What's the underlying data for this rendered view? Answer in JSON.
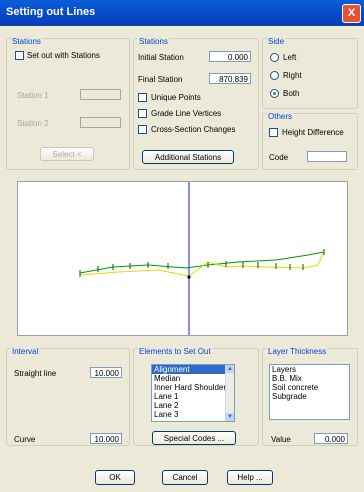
{
  "window": {
    "title": "Setting out Lines",
    "close_glyph": "X"
  },
  "stations_left": {
    "group_label": "Stations",
    "set_out_label": "Set out with Stations",
    "station1_label": "Station 1",
    "station2_label": "Station 2",
    "select_label": "Select <"
  },
  "stations_mid": {
    "group_label": "Stations",
    "initial_label": "Initial Station",
    "initial_value": "0.000",
    "final_label": "Final Station",
    "final_value": "870.839",
    "unique_points": "Unique Points",
    "grade_line": "Grade Line Vertices",
    "cross_section": "Cross-Section Changes",
    "additional_button": "Additional Stations"
  },
  "side": {
    "group_label": "Side",
    "left": "Left",
    "right": "Right",
    "both": "Both",
    "selected": "Both"
  },
  "others": {
    "group_label": "Others",
    "height_diff": "Height Difference",
    "code_label": "Code",
    "code_value": ""
  },
  "interval": {
    "group_label": "Interval",
    "straight_label": "Straight line",
    "straight_value": "10.000",
    "curve_label": "Curve",
    "curve_value": "10.000"
  },
  "elements": {
    "group_label": "Elements to Set Out",
    "items": [
      "Alignment",
      "Median",
      "Inner Hard Shoulder",
      "Lane 1",
      "Lane 2",
      "Lane 3"
    ],
    "selected": "Alignment",
    "special_button": "Special Codes ..."
  },
  "layers": {
    "group_label": "Layer Thickness",
    "items": [
      "Layers",
      "B.B. Mix",
      "Soil concrete",
      "Subgrade"
    ],
    "value_label": "Value",
    "value": "0.000"
  },
  "footer": {
    "ok": "OK",
    "cancel": "Cancel",
    "help": "Help ..."
  },
  "colors": {
    "title_bar": "#0a5ed8",
    "group_label": "#0046d5",
    "selection": "#316ac5",
    "cursor_line": "#6666ee",
    "line_green": "#009900",
    "line_yellow": "#dddd00"
  }
}
